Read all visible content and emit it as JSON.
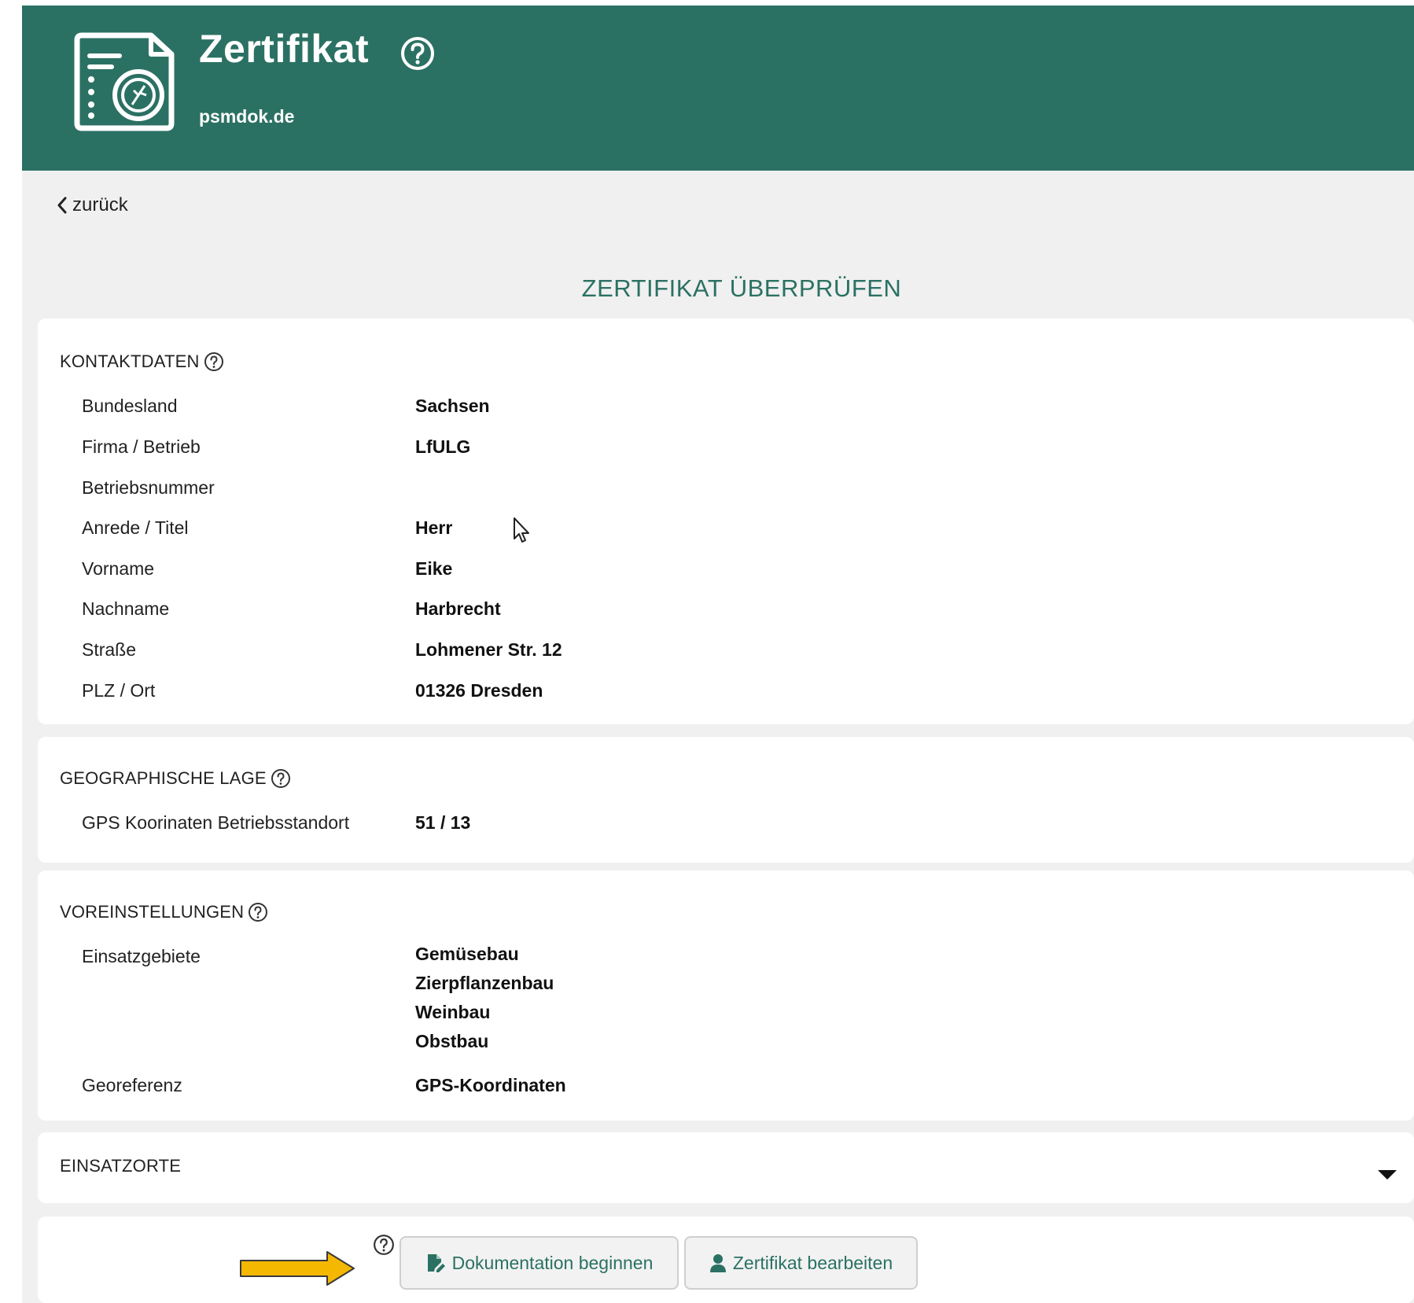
{
  "header": {
    "title": "Zertifikat",
    "subtitle": "psmdok.de",
    "logo_icon": "certificate-leaf-icon",
    "help_icon": "question-circle-icon",
    "background_color": "#2b7163"
  },
  "nav": {
    "back_label": "zurück"
  },
  "page": {
    "heading": "ZERTIFIKAT ÜBERPRÜFEN",
    "accent_color": "#2b7163"
  },
  "kontaktdaten": {
    "title": "KONTAKTDATEN",
    "rows": [
      {
        "label": "Bundesland",
        "value": "Sachsen"
      },
      {
        "label": "Firma / Betrieb",
        "value": "LfULG"
      },
      {
        "label": "Betriebsnummer",
        "value": ""
      },
      {
        "label": "Anrede / Titel",
        "value": "Herr"
      },
      {
        "label": "Vorname",
        "value": "Eike"
      },
      {
        "label": "Nachname",
        "value": "Harbrecht"
      },
      {
        "label": "Straße",
        "value": "Lohmener Str. 12"
      },
      {
        "label": "PLZ / Ort",
        "value": "01326 Dresden"
      }
    ]
  },
  "geographische_lage": {
    "title": "GEOGRAPHISCHE LAGE",
    "rows": [
      {
        "label": "GPS Koorinaten Betriebsstandort",
        "value": "51 / 13"
      }
    ]
  },
  "voreinstellungen": {
    "title": "VOREINSTELLUNGEN",
    "einsatzgebiete_label": "Einsatzgebiete",
    "einsatzgebiete": [
      "Gemüsebau",
      "Zierpflanzenbau",
      "Weinbau",
      "Obstbau"
    ],
    "georeferenz_label": "Georeferenz",
    "georeferenz_value": "GPS-Koordinaten"
  },
  "einsatzorte": {
    "title": "EINSATZORTE",
    "expand_icon": "caret-down-icon"
  },
  "actions": {
    "help_icon": "question-circle-icon",
    "start_documentation_label": "Dokumentation beginnen",
    "start_documentation_icon": "file-edit-icon",
    "edit_certificate_label": "Zertifikat bearbeiten",
    "edit_certificate_icon": "user-icon",
    "annotation_arrow_color": "#f5b800"
  }
}
